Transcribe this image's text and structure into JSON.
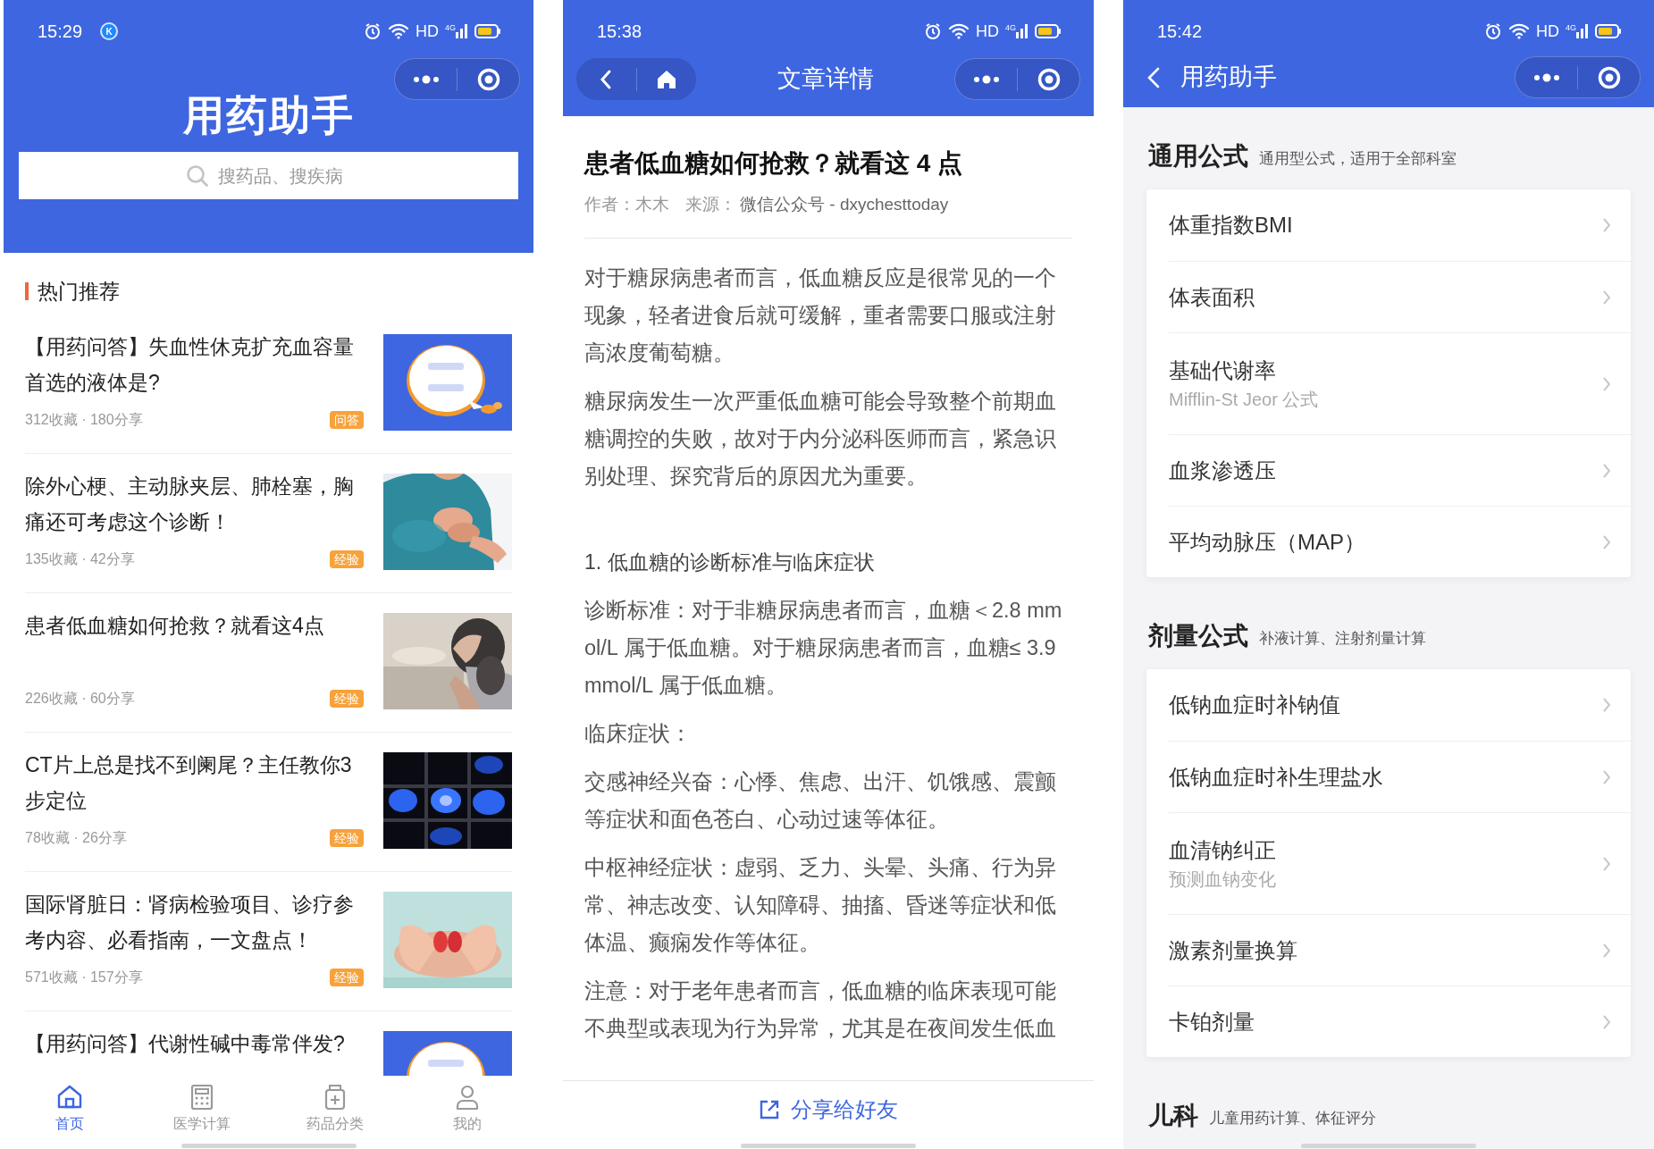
{
  "home_screen": {
    "status_bar": {
      "time": "15:29",
      "notification": "K",
      "network": "HD",
      "signal": "4G"
    },
    "app_title": "用药助手",
    "search": {
      "placeholder": "搜药品、搜疾病"
    },
    "section_title": "热门推荐",
    "articles": [
      {
        "title": "【用药问答】失血性休克扩充血容量首选的液体是?",
        "meta": "312收藏 · 180分享",
        "tag": "问答"
      },
      {
        "title": "除外心梗、主动脉夹层、肺栓塞，胸痛还可考虑这个诊断！",
        "meta": "135收藏 · 42分享",
        "tag": "经验"
      },
      {
        "title": "患者低血糖如何抢救？就看这4点",
        "meta": "226收藏 · 60分享",
        "tag": "经验"
      },
      {
        "title": "CT片上总是找不到阑尾？主任教你3步定位",
        "meta": "78收藏 · 26分享",
        "tag": "经验"
      },
      {
        "title": "国际肾脏日：肾病检验项目、诊疗参考内容、必看指南，一文盘点！",
        "meta": "571收藏 · 157分享",
        "tag": "经验"
      },
      {
        "title": "【用药问答】代谢性碱中毒常伴发?"
      }
    ],
    "tabbar": [
      {
        "label": "首页",
        "selected": true
      },
      {
        "label": "医学计算",
        "selected": false
      },
      {
        "label": "药品分类",
        "selected": false
      },
      {
        "label": "我的",
        "selected": false
      }
    ]
  },
  "article_screen": {
    "status_bar": {
      "time": "15:38",
      "network": "HD",
      "signal": "4G"
    },
    "nav_title": "文章详情",
    "title": "患者低血糖如何抢救？就看这 4 点",
    "author": "作者：木木",
    "source_label": "来源：",
    "source": "微信公众号 - dxychesttoday",
    "body": [
      {
        "kind": "paragraph",
        "text": "对于糖尿病患者而言，低血糖反应是很常见的一个现象，轻者进食后就可缓解，重者需要口服或注射高浓度葡萄糖。"
      },
      {
        "kind": "paragraph",
        "text": "糖尿病发生一次严重低血糖可能会导致整个前期血糖调控的失败，故对于内分泌科医师而言，紧急识别处理、探究背后的原因尤为重要。"
      },
      {
        "kind": "heading",
        "text": "1. 低血糖的诊断标准与临床症状"
      },
      {
        "kind": "paragraph",
        "text": "诊断标准：对于非糖尿病患者而言，血糖＜2.8 mmol/L 属于低血糖。对于糖尿病患者而言，血糖≤ 3.9 mmol/L 属于低血糖。"
      },
      {
        "kind": "paragraph",
        "text": "临床症状："
      },
      {
        "kind": "paragraph",
        "text": "交感神经兴奋：心悸、焦虑、出汗、饥饿感、震颤等症状和面色苍白、心动过速等体征。"
      },
      {
        "kind": "paragraph",
        "text": "中枢神经症状：虚弱、乏力、头晕、头痛、行为异常、神志改变、认知障碍、抽搐、昏迷等症状和低体温、癫痫发作等体征。"
      },
      {
        "kind": "paragraph",
        "text": "注意：对于老年患者而言，低血糖的临床表现可能不典型或表现为行为异常，尤其是在夜间发生低血"
      }
    ],
    "share_button": "分享给好友"
  },
  "calculator_screen": {
    "status_bar": {
      "time": "15:42",
      "network": "HD",
      "signal": "4G"
    },
    "nav_title": "用药助手",
    "sections": [
      {
        "title": "通用公式",
        "subtitle": "通用型公式，适用于全部科室",
        "items": [
          {
            "label": "体重指数BMI"
          },
          {
            "label": "体表面积"
          },
          {
            "label": "基础代谢率",
            "sublabel": "Mifflin-St Jeor 公式"
          },
          {
            "label": "血浆渗透压"
          },
          {
            "label": "平均动脉压（MAP）"
          }
        ]
      },
      {
        "title": "剂量公式",
        "subtitle": "补液计算、注射剂量计算",
        "items": [
          {
            "label": "低钠血症时补钠值"
          },
          {
            "label": "低钠血症时补生理盐水"
          },
          {
            "label": "血清钠纠正",
            "sublabel": "预测血钠变化"
          },
          {
            "label": "激素剂量换算"
          },
          {
            "label": "卡铂剂量"
          }
        ]
      },
      {
        "title": "儿科",
        "subtitle": "儿童用药计算、体征评分"
      }
    ]
  }
}
